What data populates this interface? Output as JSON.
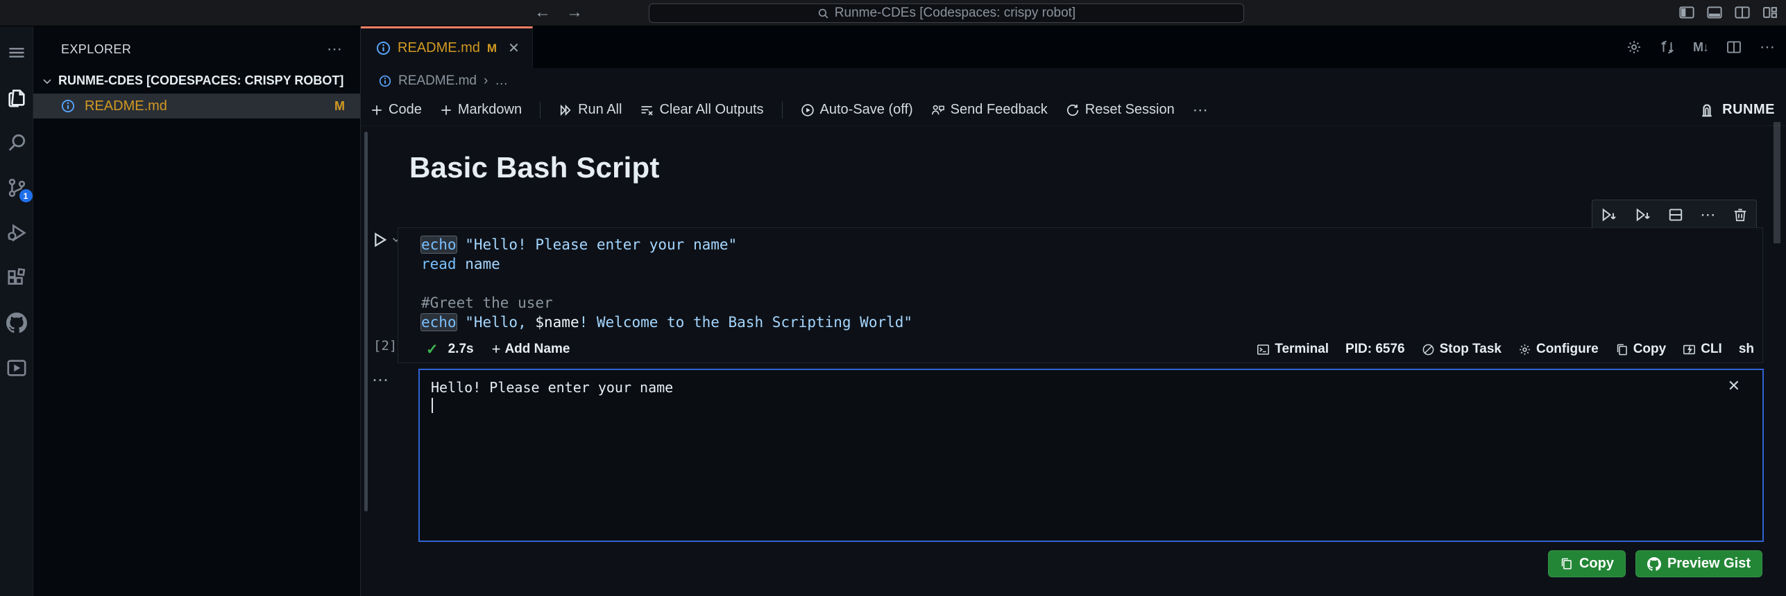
{
  "titlebar": {
    "search_placeholder": "Runme-CDEs [Codespaces: crispy robot]",
    "back_icon": "←",
    "forward_icon": "→"
  },
  "activity_bar": {
    "source_control_badge": "1"
  },
  "sidebar": {
    "header": "EXPLORER",
    "header_more": "⋯",
    "section_label": "RUNME-CDES [CODESPACES: CRISPY ROBOT]",
    "file": {
      "name": "README.md",
      "git_badge": "M"
    }
  },
  "tab": {
    "name": "README.md",
    "dirty_badge": "M",
    "close_icon": "✕",
    "markdown_action": "M↓",
    "more_icon": "⋯"
  },
  "breadcrumb": {
    "file": "README.md",
    "separator": "›",
    "more": "…"
  },
  "nbtoolbar": {
    "code": "Code",
    "markdown": "Markdown",
    "run_all": "Run All",
    "clear_all_outputs": "Clear All Outputs",
    "auto_save": "Auto-Save (off)",
    "send_feedback": "Send Feedback",
    "reset_session": "Reset Session",
    "more_icon": "⋯",
    "brand": "RUNME"
  },
  "notebook": {
    "heading": "Basic Bash Script",
    "cell": {
      "exec_count": "[2]",
      "duration": "2.7s",
      "add_name": "Add Name",
      "code_lines": [
        [
          {
            "t": "cmdhl",
            "v": "echo"
          },
          {
            "t": "str",
            "v": " \"Hello! Please enter your name\""
          }
        ],
        [
          {
            "t": "cmd",
            "v": "read"
          },
          {
            "t": "str",
            "v": " name"
          }
        ],
        [],
        [
          {
            "t": "com",
            "v": "#Greet the user"
          }
        ],
        [
          {
            "t": "cmdhl",
            "v": "echo"
          },
          {
            "t": "str",
            "v": " \"Hello, "
          },
          {
            "t": "var",
            "v": "$name"
          },
          {
            "t": "str",
            "v": "! Welcome to the Bash Scripting World\""
          }
        ]
      ],
      "status_right": {
        "terminal": "Terminal",
        "pid": "PID: 6576",
        "stop_task": "Stop Task",
        "configure": "Configure",
        "copy": "Copy",
        "cli": "CLI",
        "language": "sh"
      }
    },
    "output": {
      "line1": "Hello! Please enter your name",
      "close_icon": "✕",
      "kebab": "⋯"
    },
    "actions": {
      "copy": "Copy",
      "preview_gist": "Preview Gist"
    }
  },
  "colors": {
    "tab_accent": "#f78166",
    "git_modified": "#d29922",
    "focus_border": "#3163d2",
    "button_green": "#238636",
    "badge_blue": "#1f6feb",
    "code_keyword": "#79c0ff",
    "code_string": "#a5d6ff",
    "code_comment": "#8b949e",
    "success_green": "#3fb950"
  }
}
